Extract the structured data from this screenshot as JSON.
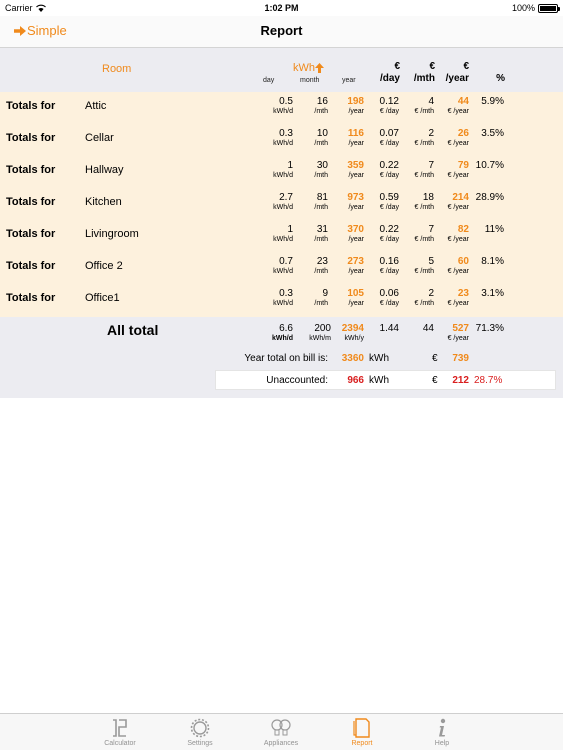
{
  "status": {
    "carrier": "Carrier",
    "time": "1:02 PM",
    "battery": "100%"
  },
  "nav": {
    "back_label": "Simple",
    "title": "Report"
  },
  "colors": {
    "accent": "#f08a1c",
    "warning": "#d91e1e",
    "row_bg": "#fdf1dd",
    "panel_bg": "#ececf1"
  },
  "header": {
    "room": "Room",
    "kwh": "kWh",
    "day": "day",
    "month": "month",
    "year": "year",
    "eur_day": [
      "€",
      "/day"
    ],
    "eur_mth": [
      "€",
      "/mth"
    ],
    "eur_year": [
      "€",
      "/year"
    ],
    "pct": "%"
  },
  "rows": [
    {
      "label": "Totals for",
      "room": "Attic",
      "kwh_day": "0.5",
      "kwh_mth": "16",
      "kwh_year": "198",
      "eur_day": "0.12",
      "eur_mth": "4",
      "eur_year": "44",
      "pct": "5.9%"
    },
    {
      "label": "Totals for",
      "room": "Cellar",
      "kwh_day": "0.3",
      "kwh_mth": "10",
      "kwh_year": "116",
      "eur_day": "0.07",
      "eur_mth": "2",
      "eur_year": "26",
      "pct": "3.5%"
    },
    {
      "label": "Totals for",
      "room": "Hallway",
      "kwh_day": "1",
      "kwh_mth": "30",
      "kwh_year": "359",
      "eur_day": "0.22",
      "eur_mth": "7",
      "eur_year": "79",
      "pct": "10.7%"
    },
    {
      "label": "Totals for",
      "room": "Kitchen",
      "kwh_day": "2.7",
      "kwh_mth": "81",
      "kwh_year": "973",
      "eur_day": "0.59",
      "eur_mth": "18",
      "eur_year": "214",
      "pct": "28.9%"
    },
    {
      "label": "Totals for",
      "room": "Livingroom",
      "kwh_day": "1",
      "kwh_mth": "31",
      "kwh_year": "370",
      "eur_day": "0.22",
      "eur_mth": "7",
      "eur_year": "82",
      "pct": "11%"
    },
    {
      "label": "Totals for",
      "room": "Office 2",
      "kwh_day": "0.7",
      "kwh_mth": "23",
      "kwh_year": "273",
      "eur_day": "0.16",
      "eur_mth": "5",
      "eur_year": "60",
      "pct": "8.1%"
    },
    {
      "label": "Totals for",
      "room": "Office1",
      "kwh_day": "0.3",
      "kwh_mth": "9",
      "kwh_year": "105",
      "eur_day": "0.06",
      "eur_mth": "2",
      "eur_year": "23",
      "pct": "3.1%"
    }
  ],
  "units": {
    "kwh_day": "kWh/d",
    "kwh_mth": "/mth",
    "kwh_year": "/year",
    "eur_day": "€ /day",
    "eur_mth": "€ /mth",
    "eur_year": "€ /year"
  },
  "all_total": {
    "title": "All total",
    "kwh_day": "6.6",
    "kwh_mth": "200",
    "kwh_year": "2394",
    "eur_day": "1.44",
    "eur_mth": "44",
    "eur_year": "527",
    "pct": "71.3%",
    "u_kwh_day": "kWh/d",
    "u_kwh_mth": "kWh/m",
    "u_kwh_year": "kWh/y",
    "u_eur_year": "€ /year"
  },
  "bill": {
    "label": "Year total on bill is:",
    "kwh": "3360",
    "kwh_unit": "kWh",
    "eur_sign": "€",
    "eur": "739"
  },
  "unaccounted": {
    "label": "Unaccounted:",
    "kwh": "966",
    "kwh_unit": "kWh",
    "eur_sign": "€",
    "eur": "212",
    "pct": "28.7%"
  },
  "tabs": [
    {
      "label": "Calculator",
      "icon": "calculator-icon"
    },
    {
      "label": "Settings",
      "icon": "gear-icon"
    },
    {
      "label": "Appliances",
      "icon": "bulbs-icon"
    },
    {
      "label": "Report",
      "icon": "report-icon"
    },
    {
      "label": "Help",
      "icon": "info-icon"
    }
  ]
}
